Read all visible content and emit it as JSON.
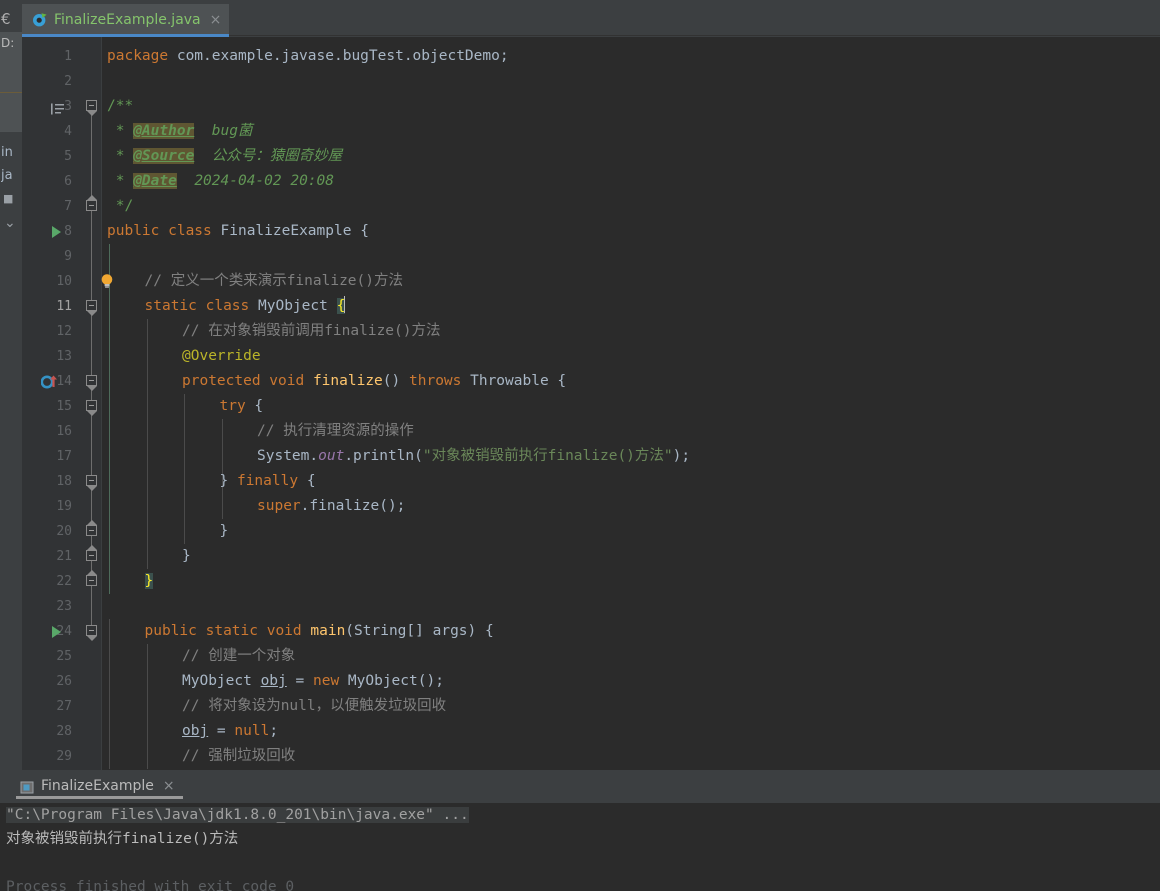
{
  "window": {
    "tab": {
      "icon": "java-class-icon",
      "label": "FinalizeExample.java",
      "close": "×"
    }
  },
  "sidebar": {
    "cut_items": [
      {
        "label": "€",
        "name": "project-icon-partial"
      },
      {
        "label": "D:",
        "name": "project-path-partial"
      },
      {
        "label": "in",
        "name": "tree-node-partial-1"
      },
      {
        "label": "ja",
        "name": "tree-node-partial-2"
      },
      {
        "label": "■",
        "name": "tree-node-partial-3"
      },
      {
        "label": "⌄",
        "name": "tree-collapse-partial"
      }
    ]
  },
  "editor": {
    "caret_line": 11,
    "lines": [
      {
        "n": 1,
        "indent": 0,
        "fold": null,
        "icon": null,
        "tokens": [
          {
            "t": "package ",
            "c": "kw"
          },
          {
            "t": "com.example.javase.bugTest.objectDemo;",
            "c": "id"
          }
        ]
      },
      {
        "n": 2,
        "indent": 0,
        "fold": null,
        "icon": null,
        "tokens": []
      },
      {
        "n": 3,
        "indent": 0,
        "fold": "start",
        "icon": "javadoc-icon",
        "tokens": [
          {
            "t": "/**",
            "c": "jdoc"
          }
        ]
      },
      {
        "n": 4,
        "indent": 0,
        "fold": null,
        "icon": null,
        "tokens": [
          {
            "t": " * ",
            "c": "jdoc"
          },
          {
            "t": "@Author",
            "c": "jtag"
          },
          {
            "t": "  bug菌",
            "c": "jtxt"
          }
        ]
      },
      {
        "n": 5,
        "indent": 0,
        "fold": null,
        "icon": null,
        "tokens": [
          {
            "t": " * ",
            "c": "jdoc"
          },
          {
            "t": "@Source",
            "c": "jtag"
          },
          {
            "t": "  公众号：猿圈奇妙屋",
            "c": "jtxt"
          }
        ]
      },
      {
        "n": 6,
        "indent": 0,
        "fold": null,
        "icon": null,
        "tokens": [
          {
            "t": " * ",
            "c": "jdoc"
          },
          {
            "t": "@Date",
            "c": "jtag"
          },
          {
            "t": "  2024-04-02 20:08",
            "c": "jtxt"
          }
        ]
      },
      {
        "n": 7,
        "indent": 0,
        "fold": "end",
        "icon": null,
        "tokens": [
          {
            "t": " */",
            "c": "jdoc"
          }
        ]
      },
      {
        "n": 8,
        "indent": 0,
        "fold": null,
        "icon": "run-arrow",
        "tokens": [
          {
            "t": "public class ",
            "c": "kw"
          },
          {
            "t": "FinalizeExample ",
            "c": "cls"
          },
          {
            "t": "{",
            "c": "brc"
          }
        ]
      },
      {
        "n": 9,
        "indent": 0,
        "fold": null,
        "icon": null,
        "tokens": []
      },
      {
        "n": 10,
        "indent": 1,
        "fold": null,
        "icon": "bulb-icon",
        "tokens": [
          {
            "t": "// 定义一个类来演示finalize()方法",
            "c": "cm"
          }
        ]
      },
      {
        "n": 11,
        "indent": 1,
        "fold": "start",
        "icon": null,
        "tokens": [
          {
            "t": "static class ",
            "c": "kw"
          },
          {
            "t": "MyObject ",
            "c": "cls"
          },
          {
            "t": "{",
            "c": "brmatch"
          },
          {
            "t": "",
            "c": "caret"
          }
        ]
      },
      {
        "n": 12,
        "indent": 2,
        "fold": null,
        "icon": null,
        "tokens": [
          {
            "t": "// 在对象销毁前调用finalize()方法",
            "c": "cm"
          }
        ]
      },
      {
        "n": 13,
        "indent": 2,
        "fold": null,
        "icon": null,
        "tokens": [
          {
            "t": "@Override",
            "c": "ann"
          }
        ]
      },
      {
        "n": 14,
        "indent": 2,
        "fold": "start",
        "icon": "override-icon",
        "tokens": [
          {
            "t": "protected void ",
            "c": "kw"
          },
          {
            "t": "finalize",
            "c": "mth"
          },
          {
            "t": "() ",
            "c": "brc"
          },
          {
            "t": "throws ",
            "c": "kw"
          },
          {
            "t": "Throwable ",
            "c": "cls"
          },
          {
            "t": "{",
            "c": "brc"
          }
        ]
      },
      {
        "n": 15,
        "indent": 3,
        "fold": "start",
        "icon": null,
        "tokens": [
          {
            "t": "try ",
            "c": "kw"
          },
          {
            "t": "{",
            "c": "brc"
          }
        ]
      },
      {
        "n": 16,
        "indent": 4,
        "fold": null,
        "icon": null,
        "tokens": [
          {
            "t": "// 执行清理资源的操作",
            "c": "cm"
          }
        ]
      },
      {
        "n": 17,
        "indent": 4,
        "fold": null,
        "icon": null,
        "tokens": [
          {
            "t": "System.",
            "c": "id"
          },
          {
            "t": "out",
            "c": "stat"
          },
          {
            "t": ".println(",
            "c": "id"
          },
          {
            "t": "\"对象被销毁前执行finalize()方法\"",
            "c": "str"
          },
          {
            "t": ");",
            "c": "id"
          }
        ]
      },
      {
        "n": 18,
        "indent": 3,
        "fold": "start",
        "icon": null,
        "tokens": [
          {
            "t": "} ",
            "c": "brc"
          },
          {
            "t": "finally ",
            "c": "kw"
          },
          {
            "t": "{",
            "c": "brc"
          }
        ]
      },
      {
        "n": 19,
        "indent": 4,
        "fold": null,
        "icon": null,
        "tokens": [
          {
            "t": "super",
            "c": "kw"
          },
          {
            "t": ".finalize();",
            "c": "id"
          }
        ]
      },
      {
        "n": 20,
        "indent": 3,
        "fold": "end",
        "icon": null,
        "tokens": [
          {
            "t": "}",
            "c": "brc"
          }
        ]
      },
      {
        "n": 21,
        "indent": 2,
        "fold": "end",
        "icon": null,
        "tokens": [
          {
            "t": "}",
            "c": "brc"
          }
        ]
      },
      {
        "n": 22,
        "indent": 1,
        "fold": "end",
        "icon": null,
        "tokens": [
          {
            "t": "}",
            "c": "brmatch"
          }
        ]
      },
      {
        "n": 23,
        "indent": 0,
        "fold": null,
        "icon": null,
        "tokens": []
      },
      {
        "n": 24,
        "indent": 1,
        "fold": "start",
        "icon": "run-arrow",
        "tokens": [
          {
            "t": "public static void ",
            "c": "kw"
          },
          {
            "t": "main",
            "c": "mth"
          },
          {
            "t": "(",
            "c": "brc"
          },
          {
            "t": "String",
            "c": "cls"
          },
          {
            "t": "[] args) ",
            "c": "id"
          },
          {
            "t": "{",
            "c": "brc"
          }
        ]
      },
      {
        "n": 25,
        "indent": 2,
        "fold": null,
        "icon": null,
        "tokens": [
          {
            "t": "// 创建一个对象",
            "c": "cm"
          }
        ]
      },
      {
        "n": 26,
        "indent": 2,
        "fold": null,
        "icon": null,
        "tokens": [
          {
            "t": "MyObject ",
            "c": "cls"
          },
          {
            "t": "obj",
            "c": "lvar"
          },
          {
            "t": " = ",
            "c": "id"
          },
          {
            "t": "new ",
            "c": "kw"
          },
          {
            "t": "MyObject();",
            "c": "id"
          }
        ]
      },
      {
        "n": 27,
        "indent": 2,
        "fold": null,
        "icon": null,
        "tokens": [
          {
            "t": "// 将对象设为null，以便触发垃圾回收",
            "c": "cm"
          }
        ]
      },
      {
        "n": 28,
        "indent": 2,
        "fold": null,
        "icon": null,
        "tokens": [
          {
            "t": "obj",
            "c": "lvar"
          },
          {
            "t": " = ",
            "c": "id"
          },
          {
            "t": "null",
            "c": "kw"
          },
          {
            "t": ";",
            "c": "id"
          }
        ]
      },
      {
        "n": 29,
        "indent": 2,
        "fold": null,
        "icon": null,
        "tokens": [
          {
            "t": "// 强制垃圾回收",
            "c": "cm"
          }
        ]
      }
    ]
  },
  "run_panel": {
    "tab": {
      "icon": "console-icon",
      "label": "FinalizeExample",
      "close": "×"
    },
    "console_lines": [
      {
        "text": "\"C:\\Program Files\\Java\\jdk1.8.0_201\\bin\\java.exe\" ...",
        "style": "cmd"
      },
      {
        "text": "对象被销毁前执行finalize()方法",
        "style": "out"
      },
      {
        "text": "",
        "style": "out"
      },
      {
        "text": "Process finished with exit code 0",
        "style": "faded"
      }
    ]
  },
  "colors": {
    "editor_bg": "#2B2B2B",
    "chrome_bg": "#3C3F41",
    "gutter_bg": "#313335",
    "caret_line": "#323232",
    "tab_active": "#4E5254",
    "tab_underline": "#4A88C7",
    "keyword": "#CC7832",
    "identifier": "#A9B7C6",
    "comment": "#808080",
    "javadoc": "#629755",
    "javadoc_tag_bg": "#5F5632",
    "string": "#6A8759",
    "annotation": "#BBB529",
    "method": "#FFC66D",
    "static_field": "#9876AA",
    "run_green": "#59A869",
    "tab_label_green": "#85C46C",
    "brace_match_bg": "#3B514D",
    "brace_match_fg": "#FFEF28"
  }
}
